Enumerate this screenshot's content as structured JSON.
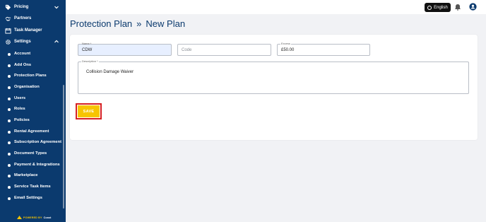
{
  "sidebar": {
    "top_items": [
      {
        "label": "Pricing",
        "icon": "tag-icon",
        "chevron": "chevron-down-icon"
      },
      {
        "label": "Partners",
        "icon": "handshake-icon"
      },
      {
        "label": "Task Manager",
        "icon": "calendar-icon"
      },
      {
        "label": "Settings",
        "icon": "gear-icon",
        "chevron": "chevron-up-icon"
      }
    ],
    "sub_items": [
      {
        "label": "Account"
      },
      {
        "label": "Add Ons"
      },
      {
        "label": "Protection Plans"
      },
      {
        "label": "Organisation"
      },
      {
        "label": "Users"
      },
      {
        "label": "Roles"
      },
      {
        "label": "Policies"
      },
      {
        "label": "Rental Agreement"
      },
      {
        "label": "Subscription Agreement"
      },
      {
        "label": "Document Types"
      },
      {
        "label": "Payment & Integrations"
      },
      {
        "label": "Marketplace"
      },
      {
        "label": "Service Task Items"
      },
      {
        "label": "Email Settings"
      }
    ],
    "powered_by": "POWERED BY",
    "powered_brand": "Coast"
  },
  "header": {
    "language": "English"
  },
  "page": {
    "title": "Protection Plan",
    "separator": "»",
    "subtitle": "New Plan"
  },
  "form": {
    "name": {
      "label": "Name *",
      "value": "CDW"
    },
    "code": {
      "placeholder": "Code"
    },
    "excess": {
      "label": "Excess",
      "value": "£50.00"
    },
    "description": {
      "label": "Description *",
      "value": "Collision Damage Waiver"
    },
    "save_label": "SAVE"
  },
  "colors": {
    "sidebar_bg": "#0b3a6e",
    "accent": "#f7c500",
    "highlight": "#d62020",
    "title": "#0b3a6e"
  }
}
